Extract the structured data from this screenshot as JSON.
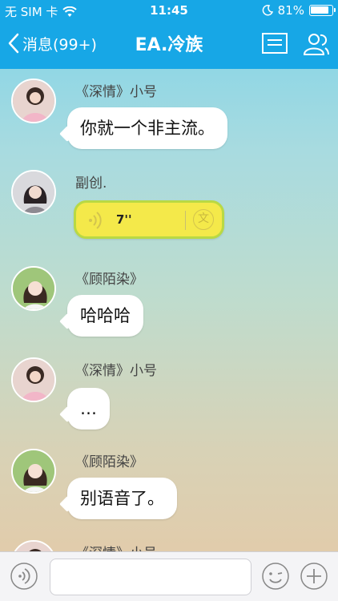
{
  "status_bar": {
    "carrier": "无 SIM 卡",
    "time": "11:45",
    "battery_percent": "81%"
  },
  "nav": {
    "back_label": "消息(99+)",
    "title": "EA.冷族"
  },
  "messages": [
    {
      "sender": "《深情》小号",
      "text": "你就一个非主流。",
      "type": "text"
    },
    {
      "sender": "副创.",
      "voice_duration": "7''",
      "type": "voice"
    },
    {
      "sender": "《顾陌染》",
      "text": "哈哈哈",
      "type": "text"
    },
    {
      "sender": "《深情》小号",
      "text": "…",
      "type": "text"
    },
    {
      "sender": "《顾陌染》",
      "text": "别语音了。",
      "type": "text"
    },
    {
      "sender": "《深情》小号",
      "type": "partial"
    }
  ],
  "voice_bubble": {
    "translate_icon_label": "文"
  },
  "colors": {
    "header_blue": "#17a7e6",
    "voice_yellow": "#f4e94a",
    "voice_border": "#b9d943"
  }
}
